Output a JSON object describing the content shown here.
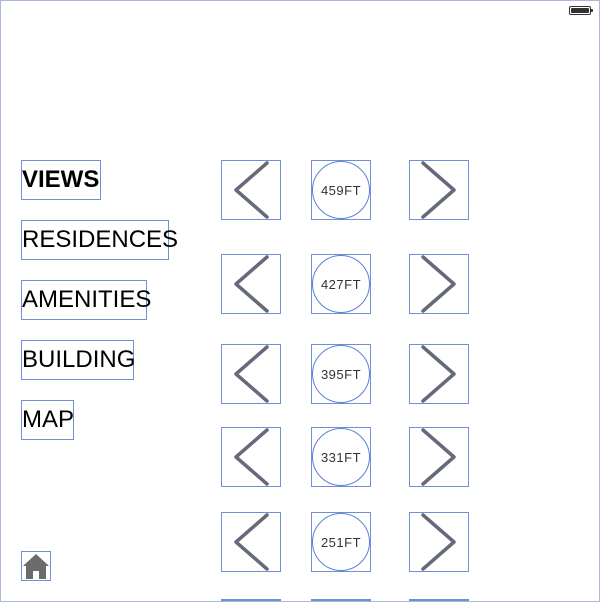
{
  "menu": {
    "items": [
      {
        "label": "VIEWS",
        "active": true
      },
      {
        "label": "RESIDENCES",
        "active": false
      },
      {
        "label": "AMENITIES",
        "active": false
      },
      {
        "label": "BUILDING",
        "active": false
      },
      {
        "label": "MAP",
        "active": false
      }
    ]
  },
  "floors": [
    {
      "height": "459FT"
    },
    {
      "height": "427FT"
    },
    {
      "height": "395FT"
    },
    {
      "height": "331FT"
    },
    {
      "height": "251FT"
    }
  ],
  "icons": {
    "prev": "chevron-left-icon",
    "next": "chevron-right-icon",
    "home": "home-icon",
    "battery": "battery-icon"
  },
  "colors": {
    "outline": "#6f8fd8",
    "chevron": "#656a7a",
    "home": "#6b6b6b"
  }
}
